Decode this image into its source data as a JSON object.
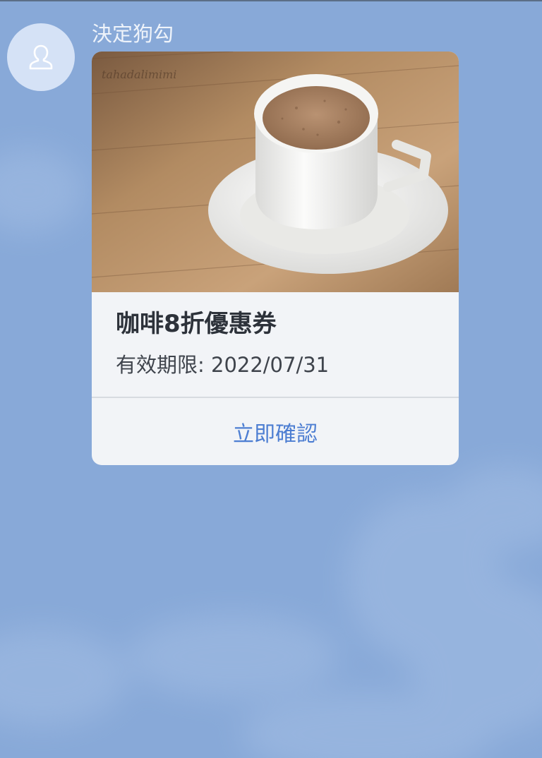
{
  "chat": {
    "sender_name": "決定狗勾",
    "avatar_icon": "person-icon"
  },
  "coupon": {
    "image_icon": "coffee-cup-photo",
    "watermark": "tahadalimimi",
    "title": "咖啡8折優惠券",
    "validity": "有效期限: 2022/07/31",
    "confirm_label": "立即確認"
  },
  "colors": {
    "background": "#88a9d8",
    "accent": "#4d7ed2"
  }
}
